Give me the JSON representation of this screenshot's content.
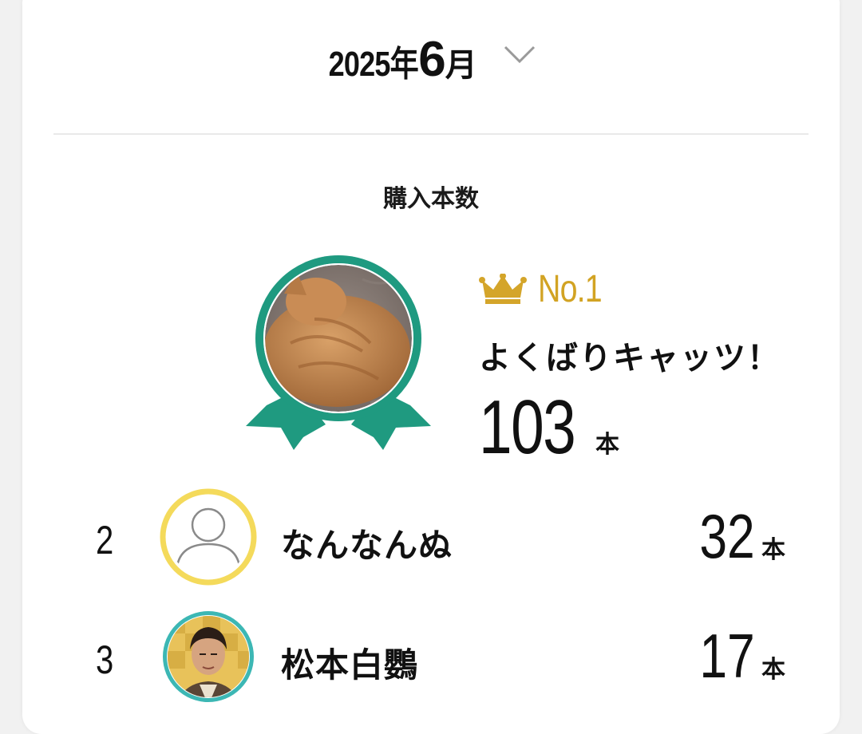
{
  "header": {
    "year_label": "2025年",
    "month_number": "6",
    "month_unit": "月",
    "dropdown_icon": "chevron-down-icon"
  },
  "section": {
    "title": "購入本数"
  },
  "colors": {
    "medal_teal": "#1f9a80",
    "crown_gold": "#d4a52a",
    "rank2_ring": "#f4da5b",
    "rank3_ring": "#3cb7b4"
  },
  "ranking": {
    "first": {
      "badge_label": "No.1",
      "crown_icon": "crown-icon",
      "name": "よくばりキャッツ！",
      "count": "103",
      "unit": "本"
    },
    "others": [
      {
        "rank": "2",
        "name": "なんなんぬ",
        "count": "32",
        "unit": "本"
      },
      {
        "rank": "3",
        "name": "松本白鸚",
        "count": "17",
        "unit": "本"
      }
    ]
  }
}
